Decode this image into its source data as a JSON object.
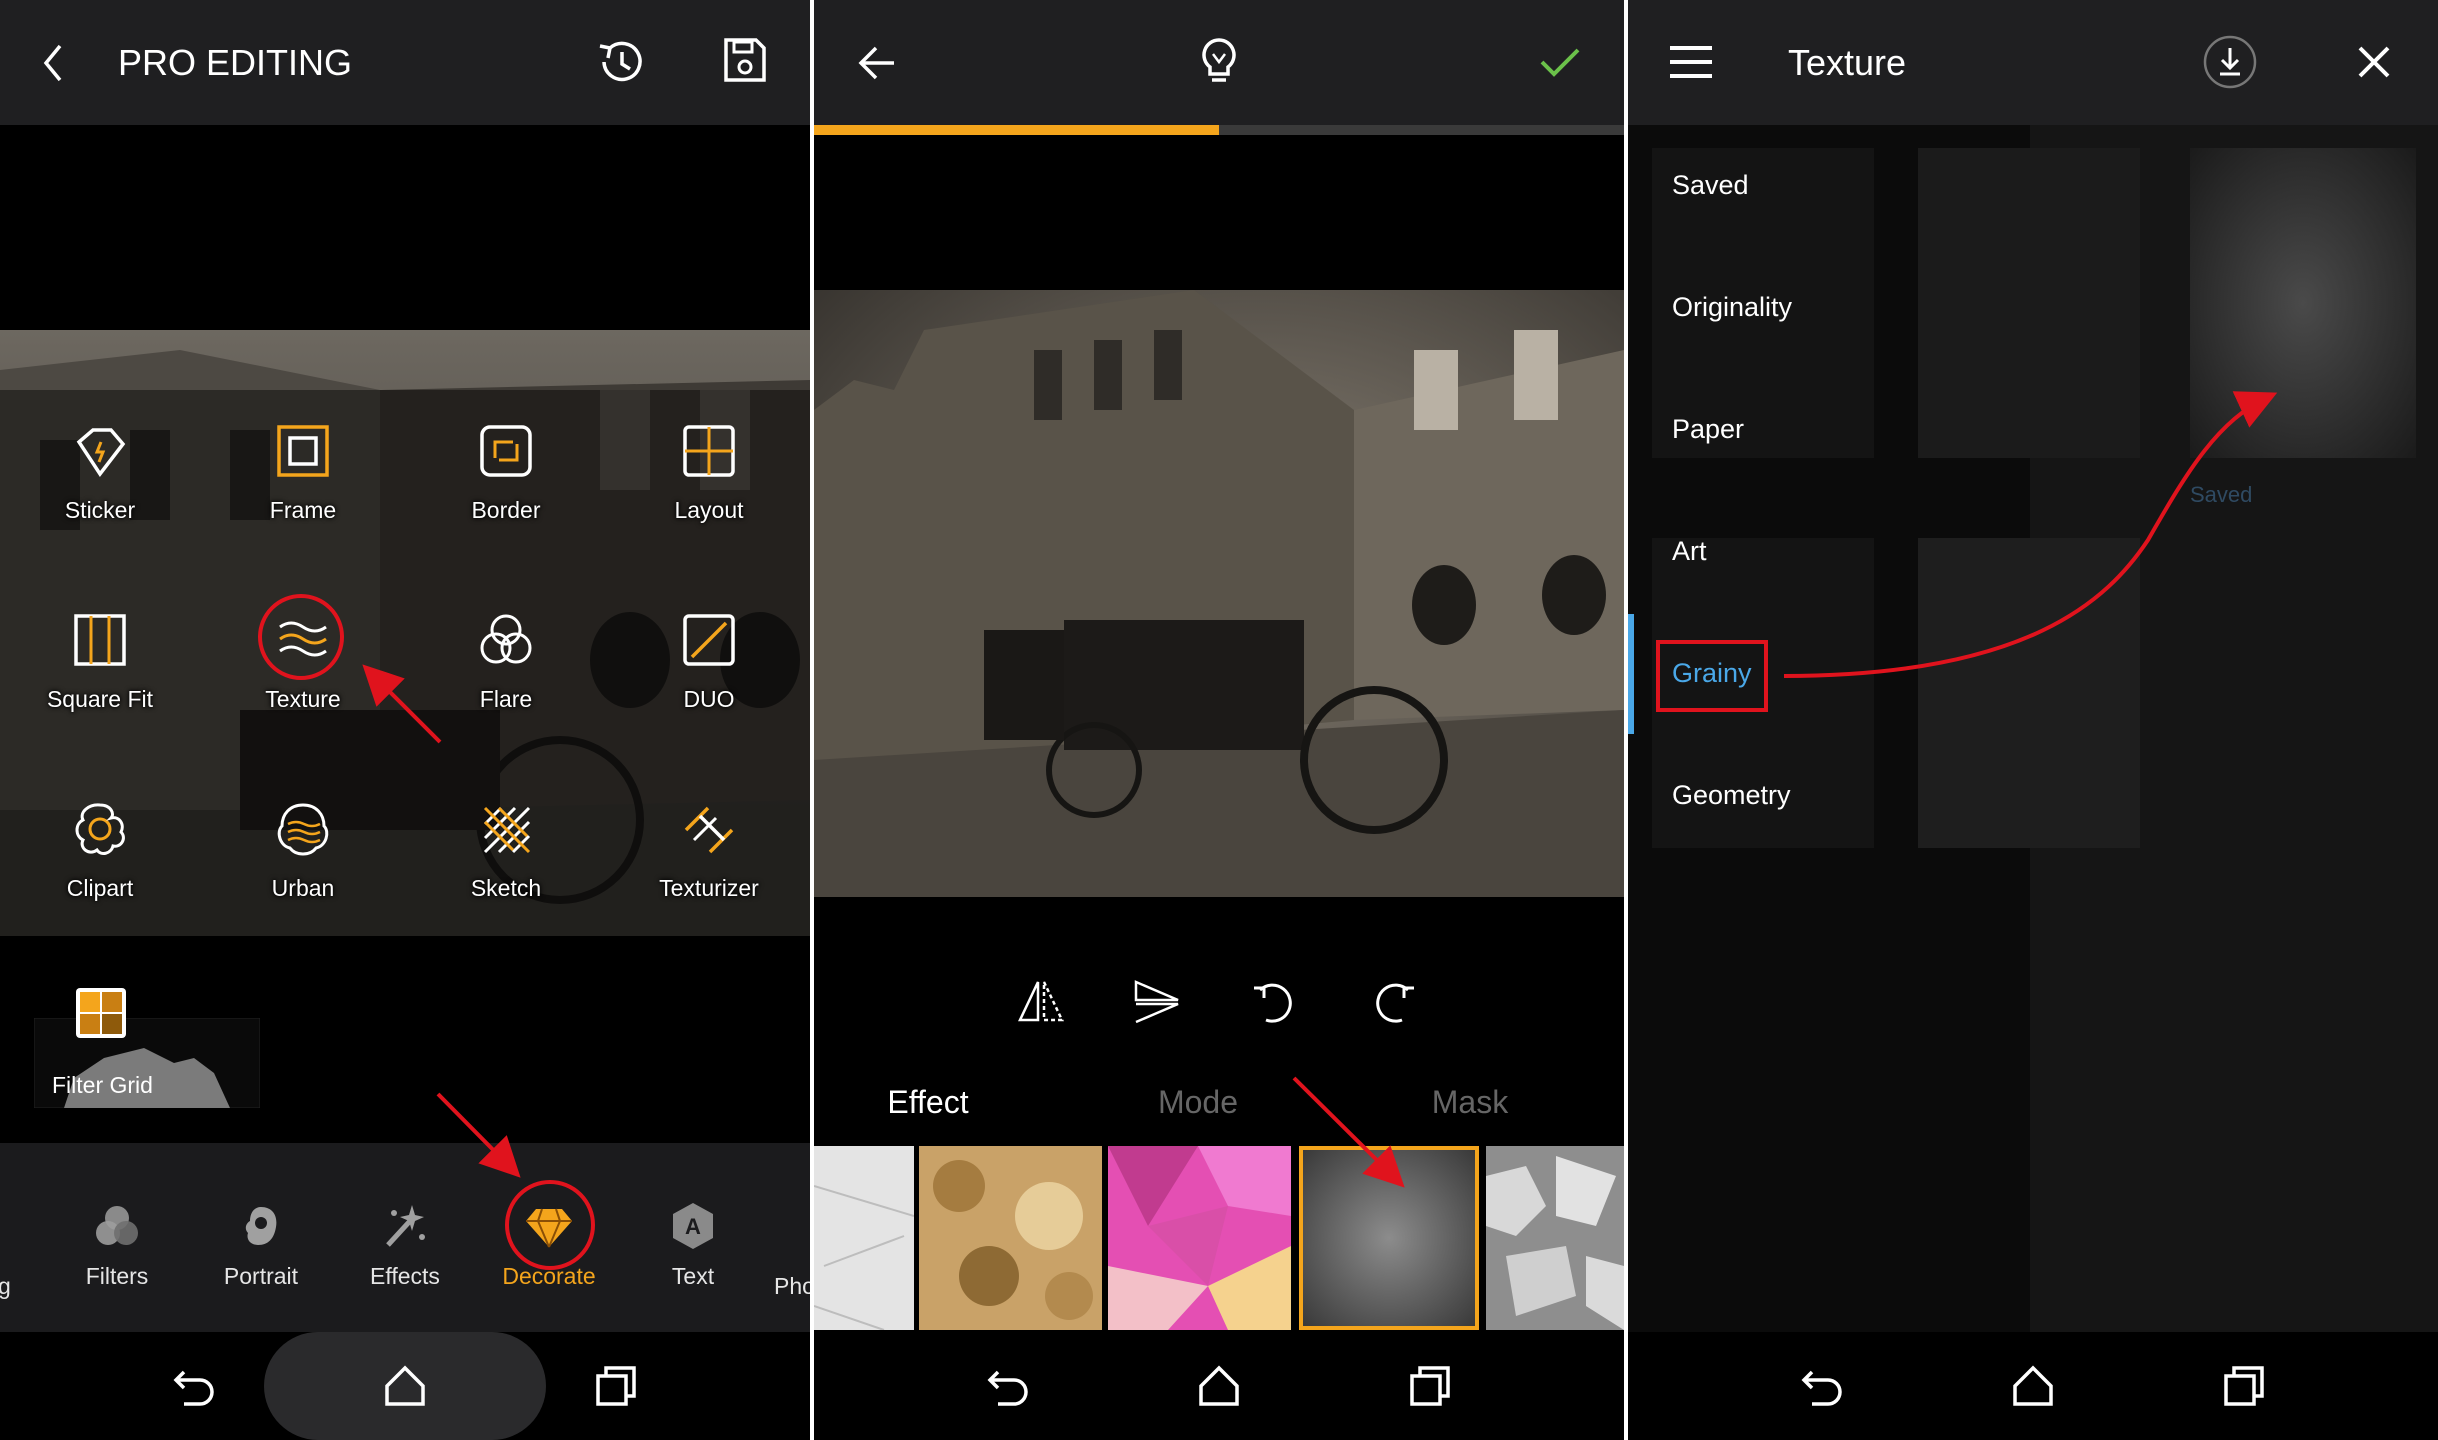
{
  "colors": {
    "accent_orange": "#f4a51c",
    "check_green": "#6bc14a",
    "blue_selected": "#4aa8e8",
    "annotation_red": "#e0131d"
  },
  "panel1": {
    "title": "PRO EDITING",
    "icons": [
      "back-chevron-icon",
      "history-icon",
      "save-icon"
    ],
    "tools": [
      {
        "label": "Sticker",
        "icon": "sticker-icon"
      },
      {
        "label": "Frame",
        "icon": "frame-icon"
      },
      {
        "label": "Border",
        "icon": "border-icon"
      },
      {
        "label": "Layout",
        "icon": "layout-icon"
      },
      {
        "label": "Square Fit",
        "icon": "square-fit-icon"
      },
      {
        "label": "Texture",
        "icon": "texture-icon"
      },
      {
        "label": "Flare",
        "icon": "flare-icon"
      },
      {
        "label": "DUO",
        "icon": "duo-icon"
      },
      {
        "label": "Clipart",
        "icon": "clipart-icon"
      },
      {
        "label": "Urban",
        "icon": "urban-icon"
      },
      {
        "label": "Sketch",
        "icon": "sketch-icon"
      },
      {
        "label": "Texturizer",
        "icon": "texturizer-icon"
      }
    ],
    "filter_grid_label": "Filter Grid",
    "bottom_tabs": [
      {
        "label": "Filters",
        "icon": "filters-icon"
      },
      {
        "label": "Portrait",
        "icon": "portrait-icon"
      },
      {
        "label": "Effects",
        "icon": "effects-icon"
      },
      {
        "label": "Decorate",
        "icon": "decorate-gem-icon",
        "active": true
      },
      {
        "label": "Text",
        "icon": "text-icon"
      },
      {
        "label": "Pho",
        "icon": ""
      }
    ],
    "left_cut_label": "g"
  },
  "panel2": {
    "icons": [
      "back-arrow-icon",
      "lightbulb-icon",
      "check-icon"
    ],
    "progress": 0.5,
    "edit_tools": [
      "flip-horizontal-icon",
      "flip-vertical-icon",
      "rotate-left-icon",
      "rotate-right-icon"
    ],
    "tabs": [
      {
        "label": "Effect",
        "active": true
      },
      {
        "label": "Mode",
        "active": false
      },
      {
        "label": "Mask",
        "active": false
      }
    ],
    "selected_thumbnail": 3
  },
  "panel3": {
    "title": "Texture",
    "icons": [
      "menu-icon",
      "download-icon",
      "close-icon"
    ],
    "categories": [
      {
        "label": "Saved"
      },
      {
        "label": "Originality"
      },
      {
        "label": "Paper"
      },
      {
        "label": "Art"
      },
      {
        "label": "Grainy",
        "active": true
      },
      {
        "label": "Geometry"
      }
    ],
    "saved_caption": "Saved"
  },
  "nav_icons": [
    "nav-back-icon",
    "nav-home-icon",
    "nav-recents-icon"
  ]
}
